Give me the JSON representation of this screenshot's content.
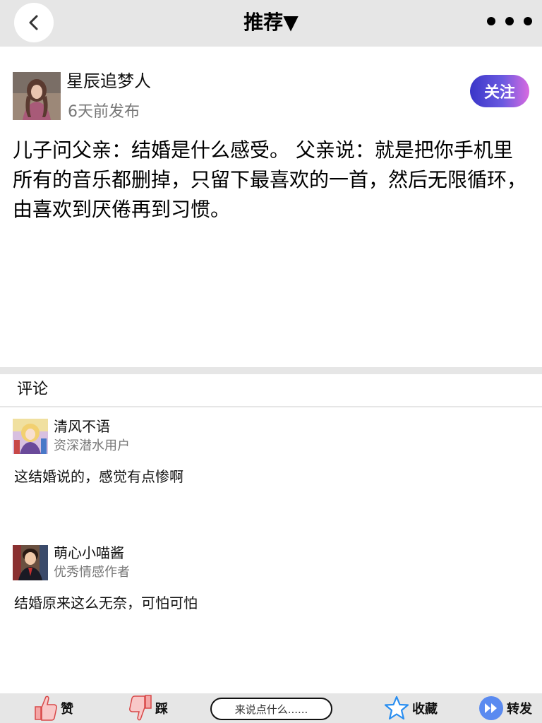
{
  "header": {
    "title": "推荐▼"
  },
  "post": {
    "author_name": "星辰追梦人",
    "time": "6天前发布",
    "follow_label": "关注",
    "content": "儿子问父亲：结婚是什么感受。 父亲说：就是把你手机里所有的音乐都删掉，只留下最喜欢的一首，然后无限循环，由喜欢到厌倦再到习惯。"
  },
  "comments_section": {
    "title": "评论",
    "items": [
      {
        "name": "清风不语",
        "badge": "资深潜水用户",
        "text": "这结婚说的，感觉有点惨啊"
      },
      {
        "name": "萌心小喵酱",
        "badge": "优秀情感作者",
        "text": "结婚原来这么无奈，可怕可怕"
      }
    ]
  },
  "bottom_bar": {
    "like_label": "赞",
    "dislike_label": "踩",
    "comment_placeholder": "来说点什么......",
    "collect_label": "收藏",
    "share_label": "转发"
  },
  "colors": {
    "bar_background": "#e6e6e6",
    "follow_gradient_start": "#3a36c8",
    "follow_gradient_end": "#d86ae0",
    "secondary_text": "#777777",
    "star_blue": "#2a8ef0",
    "share_blue": "#4a7ef0"
  },
  "icons": [
    "back-icon",
    "more-icon",
    "thumbs-up-icon",
    "thumbs-down-icon",
    "star-icon",
    "share-icon"
  ]
}
